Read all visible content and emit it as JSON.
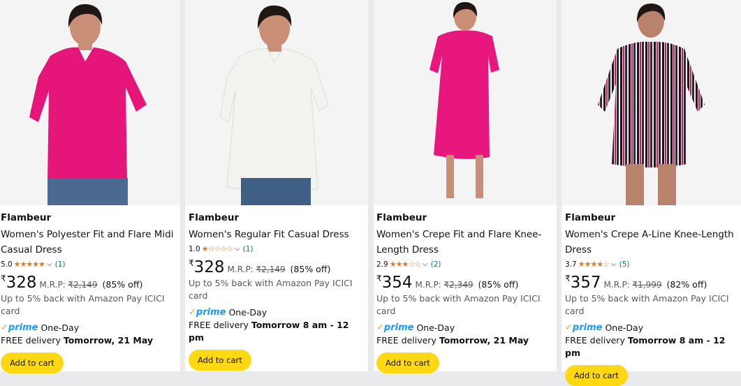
{
  "products": [
    {
      "brand": "Flambeur",
      "title_line1": "Women's Polyester Fit and Flare Midi",
      "title_line2": "Casual Dress",
      "rating": "5.0",
      "stars": "★★★★★",
      "review_count": "(1)",
      "currency": "₹",
      "price": "328",
      "mrp_label": "M.R.P:",
      "mrp": "₹2,149",
      "discount": "(85% off)",
      "cashback": "Up to 5% back with Amazon Pay ICICI card",
      "prime_check": "✓",
      "prime_word": "prime",
      "prime_speed": "One-Day",
      "delivery_prefix": "FREE delivery",
      "delivery_date": "Tomorrow, 21 May",
      "cart_label": "Add to cart",
      "dress_color": "#e5157a"
    },
    {
      "brand": "Flambeur",
      "title_line1": "Women's Regular Fit Casual Dress",
      "title_line2": "",
      "rating": "1.0",
      "stars": "★☆☆☆☆",
      "review_count": "(1)",
      "currency": "₹",
      "price": "328",
      "mrp_label": "M.R.P:",
      "mrp": "₹2,149",
      "discount": "(85% off)",
      "cashback": "Up to 5% back with Amazon Pay ICICI card",
      "prime_check": "✓",
      "prime_word": "prime",
      "prime_speed": "One-Day",
      "delivery_prefix": "FREE delivery",
      "delivery_date": "Tomorrow 8 am - 12 pm",
      "cart_label": "Add to cart",
      "dress_color": "#f4f3ef"
    },
    {
      "brand": "Flambeur",
      "title_line1": "Women's Crepe Fit and Flare Knee-",
      "title_line2": "Length Dress",
      "rating": "2.9",
      "stars": "★★★☆☆",
      "review_count": "(2)",
      "currency": "₹",
      "price": "354",
      "mrp_label": "M.R.P:",
      "mrp": "₹2,349",
      "discount": "(85% off)",
      "cashback": "Up to 5% back with Amazon Pay ICICI card",
      "prime_check": "✓",
      "prime_word": "prime",
      "prime_speed": "One-Day",
      "delivery_prefix": "FREE delivery",
      "delivery_date": "Tomorrow, 21 May",
      "cart_label": "Add to cart",
      "dress_color": "#e8177d"
    },
    {
      "brand": "Flambeur",
      "title_line1": "Women's Crepe A-Line Knee-Length",
      "title_line2": "Dress",
      "rating": "3.7",
      "stars": "★★★★☆",
      "review_count": "(5)",
      "currency": "₹",
      "price": "357",
      "mrp_label": "M.R.P:",
      "mrp": "₹1,999",
      "discount": "(82% off)",
      "cashback": "Up to 5% back with Amazon Pay ICICI card",
      "prime_check": "✓",
      "prime_word": "prime",
      "prime_speed": "One-Day",
      "delivery_prefix": "FREE delivery",
      "delivery_date": "Tomorrow 8 am - 12 pm",
      "cart_label": "Add to cart",
      "dress_color": "#2a1a22"
    }
  ],
  "colors": {
    "accent_button": "#ffd814",
    "star": "#de7921",
    "link": "#007185",
    "prime_blue": "#1a98ff",
    "prime_check": "#f7a21b"
  }
}
